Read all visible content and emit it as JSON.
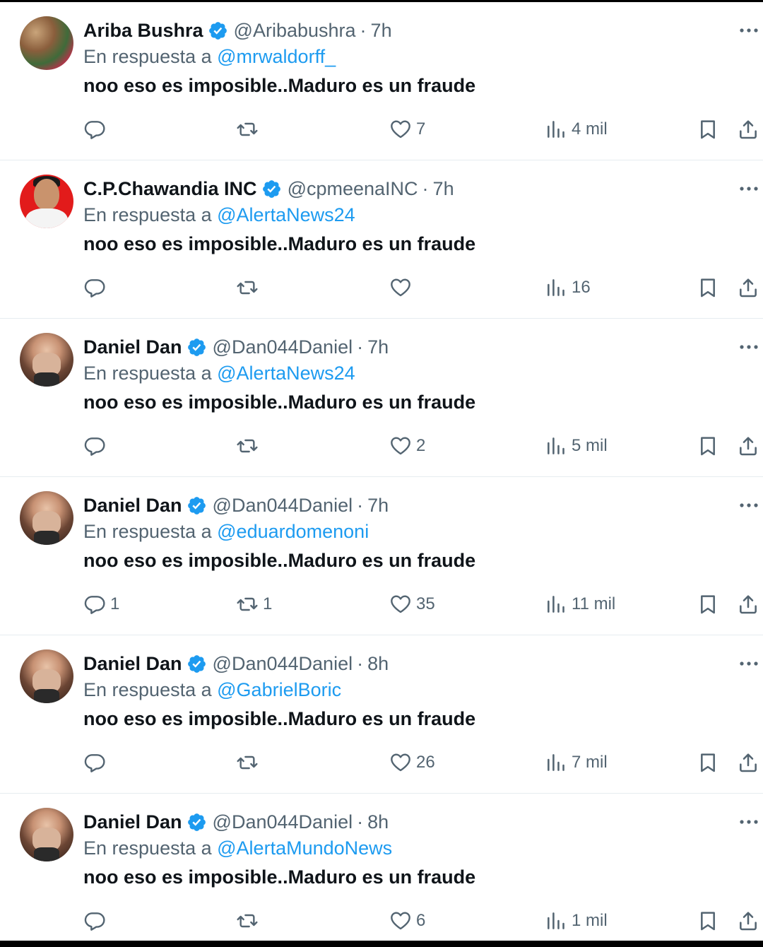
{
  "tweets": [
    {
      "name": "Ariba Bushra",
      "handle": "@Aribabushra",
      "time": "7h",
      "reply_prefix": "En respuesta a",
      "reply_to": "@mrwaldorff_",
      "text": "noo eso es imposible..Maduro es un fraude",
      "replies": "",
      "retweets": "",
      "likes": "7",
      "views": "4 mil",
      "avatar": "avatar-colorful"
    },
    {
      "name": "C.P.Chawandia INC",
      "handle": "@cpmeenaINC",
      "time": "7h",
      "reply_prefix": "En respuesta a",
      "reply_to": "@AlertaNews24",
      "text": "noo eso es imposible..Maduro es un fraude",
      "replies": "",
      "retweets": "",
      "likes": "",
      "views": "16",
      "avatar": "avatar-red"
    },
    {
      "name": "Daniel Dan",
      "handle": "@Dan044Daniel",
      "time": "7h",
      "reply_prefix": "En respuesta a",
      "reply_to": "@AlertaNews24",
      "text": "noo eso es imposible..Maduro es un fraude",
      "replies": "",
      "retweets": "",
      "likes": "2",
      "views": "5 mil",
      "avatar": "avatar-person"
    },
    {
      "name": "Daniel Dan",
      "handle": "@Dan044Daniel",
      "time": "7h",
      "reply_prefix": "En respuesta a",
      "reply_to": "@eduardomenoni",
      "text": "noo eso es imposible..Maduro es un fraude",
      "replies": "1",
      "retweets": "1",
      "likes": "35",
      "views": "11 mil",
      "avatar": "avatar-person"
    },
    {
      "name": "Daniel Dan",
      "handle": "@Dan044Daniel",
      "time": "8h",
      "reply_prefix": "En respuesta a",
      "reply_to": "@GabrielBoric",
      "text": "noo eso es imposible..Maduro es un fraude",
      "replies": "",
      "retweets": "",
      "likes": "26",
      "views": "7 mil",
      "avatar": "avatar-person"
    },
    {
      "name": "Daniel Dan",
      "handle": "@Dan044Daniel",
      "time": "8h",
      "reply_prefix": "En respuesta a",
      "reply_to": "@AlertaMundoNews",
      "text": "noo eso es imposible..Maduro es un fraude",
      "replies": "",
      "retweets": "",
      "likes": "6",
      "views": "1 mil",
      "avatar": "avatar-person"
    }
  ],
  "icons": {
    "verified": "verified-badge-icon",
    "more": "more-options-icon",
    "reply": "reply-icon",
    "retweet": "retweet-icon",
    "like": "heart-icon",
    "views": "views-chart-icon",
    "bookmark": "bookmark-icon",
    "share": "share-icon"
  },
  "colors": {
    "accent": "#1d9bf0",
    "secondary_text": "#536471",
    "primary_text": "#0f1419"
  }
}
